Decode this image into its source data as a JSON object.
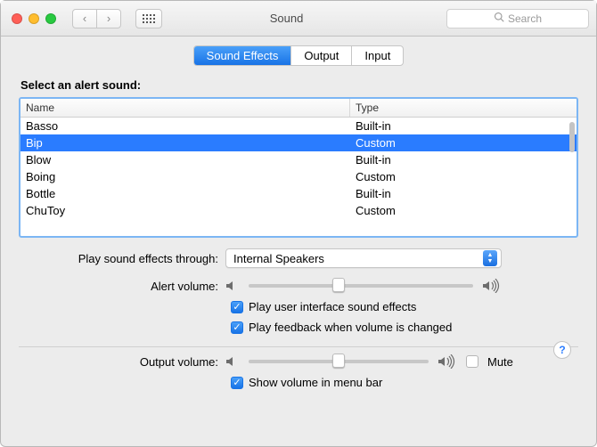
{
  "window": {
    "title": "Sound",
    "search_placeholder": "Search"
  },
  "tabs": [
    {
      "label": "Sound Effects",
      "active": true
    },
    {
      "label": "Output",
      "active": false
    },
    {
      "label": "Input",
      "active": false
    }
  ],
  "alert": {
    "section_label": "Select an alert sound:",
    "columns": {
      "name": "Name",
      "type": "Type"
    },
    "rows": [
      {
        "name": "Basso",
        "type": "Built-in",
        "selected": false
      },
      {
        "name": "Bip",
        "type": "Custom",
        "selected": true
      },
      {
        "name": "Blow",
        "type": "Built-in",
        "selected": false
      },
      {
        "name": "Boing",
        "type": "Custom",
        "selected": false
      },
      {
        "name": "Bottle",
        "type": "Built-in",
        "selected": false
      },
      {
        "name": "ChuToy",
        "type": "Custom",
        "selected": false
      }
    ]
  },
  "effects": {
    "play_through_label": "Play sound effects through:",
    "play_through_value": "Internal Speakers",
    "alert_volume_label": "Alert volume:",
    "alert_volume_percent": 40,
    "play_ui_sounds": {
      "label": "Play user interface sound effects",
      "checked": true
    },
    "play_feedback": {
      "label": "Play feedback when volume is changed",
      "checked": true
    }
  },
  "output": {
    "label": "Output volume:",
    "percent": 50,
    "mute": {
      "label": "Mute",
      "checked": false
    },
    "show_menu": {
      "label": "Show volume in menu bar",
      "checked": true
    }
  },
  "help": "?"
}
